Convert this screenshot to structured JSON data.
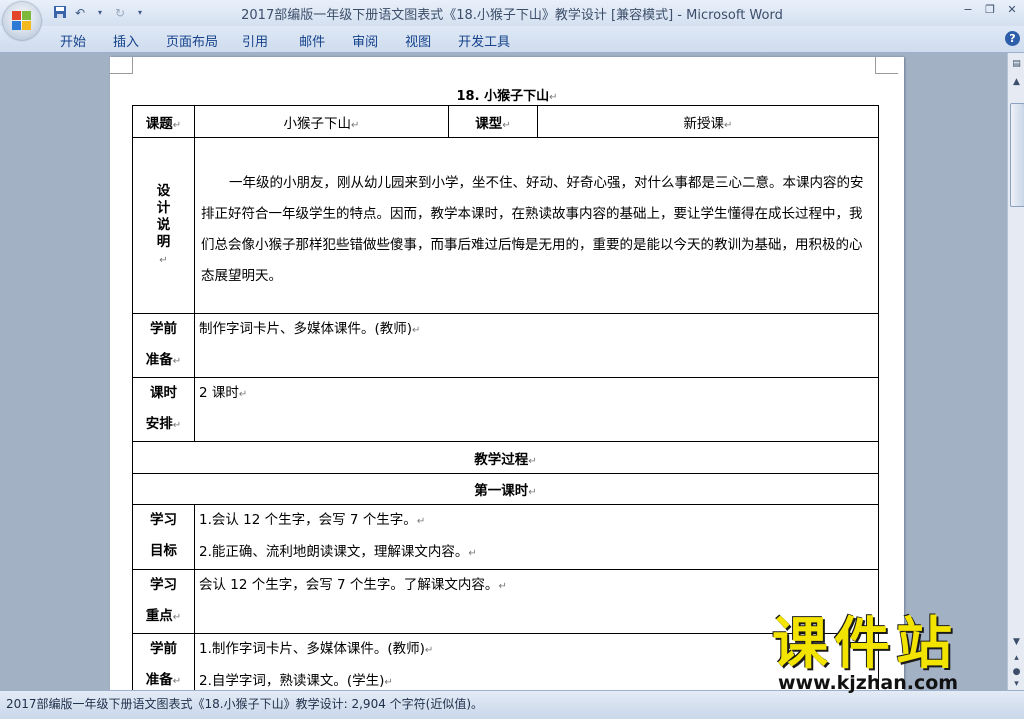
{
  "window": {
    "title": "2017部编版一年级下册语文图表式《18.小猴子下山》教学设计 [兼容模式] -",
    "app_name": "Microsoft Word"
  },
  "qat": {
    "save_icon": "save-icon",
    "undo_icon": "undo-icon",
    "redo_icon": "redo-icon"
  },
  "ribbon": {
    "tabs": [
      "开始",
      "插入",
      "页面布局",
      "引用",
      "邮件",
      "审阅",
      "视图",
      "开发工具"
    ]
  },
  "document": {
    "title": "18. 小猴子下山",
    "rows": {
      "ketilabel": "课题",
      "keti": "小猴子下山",
      "kexinglabel": "课型",
      "kexing": "新授课",
      "sheji_label": "设计说明",
      "sheji_text": "一年级的小朋友，刚从幼儿园来到小学，坐不住、好动、好奇心强，对什么事都是三心二意。本课内容的安排正好符合一年级学生的特点。因而，教学本课时，在熟读故事内容的基础上，要让学生懂得在成长过程中，我们总会像小猴子那样犯些错做些傻事，而事后难过后悔是无用的，重要的是能以今天的教训为基础，用积极的心态展望明天。",
      "xueqian_label_1": "学前",
      "xueqian_label_2": "准备",
      "xueqian_text": "制作字词卡片、多媒体课件。(教师)",
      "keshi_label_1": "课时",
      "keshi_label_2": "安排",
      "keshi_text": "2 课时",
      "jiaoxue": "教学过程",
      "diyi": "第一课时",
      "mubiao_label_1": "学习",
      "mubiao_label_2": "目标",
      "mubiao_1": "1.会认 12 个生字，会写 7 个生字。",
      "mubiao_2": "2.能正确、流利地朗读课文，理解课文内容。",
      "zhongdian_label_1": "学习",
      "zhongdian_label_2": "重点",
      "zhongdian_text": "会认 12 个生字，会写 7 个生字。了解课文内容。",
      "zhunbei_label_1": "学前",
      "zhunbei_label_2": "准备",
      "zhunbei_1": "1.制作字词卡片、多媒体课件。(教师)",
      "zhunbei_2": "2.自学字词，熟读课文。(学生)"
    }
  },
  "statusbar": {
    "text": "2017部编版一年级下册语文图表式《18.小猴子下山》教学设计: 2,904 个字符(近似值)。"
  },
  "watermark": {
    "big": "课件站",
    "url": "www.kjzhan.com"
  },
  "colors": {
    "title_bar": "#d4e0f0",
    "tab_text": "#15428b",
    "workspace": "#a3b1c4",
    "watermark": "#f3e400"
  }
}
